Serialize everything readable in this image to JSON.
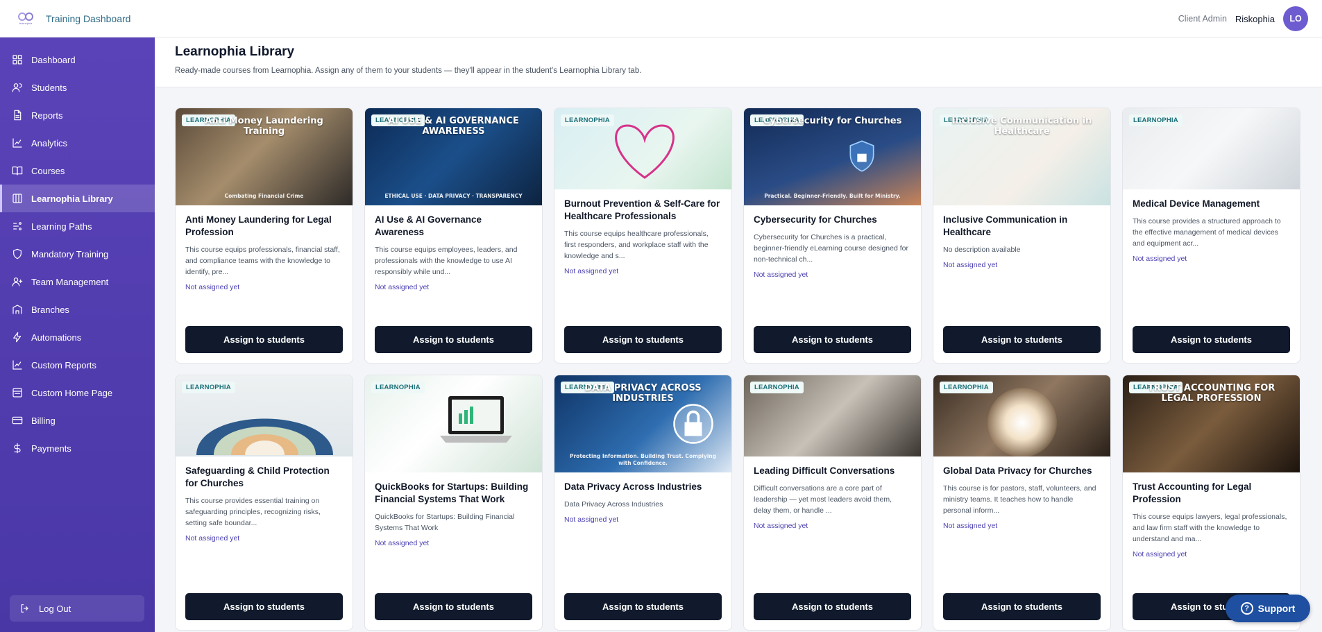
{
  "app": {
    "title": "Training Dashboard",
    "logo_text": "learnophia"
  },
  "user": {
    "role": "Client Admin",
    "org": "Riskophia",
    "initials": "LO"
  },
  "sidebar": {
    "items": [
      {
        "label": "Dashboard",
        "icon": "grid-icon"
      },
      {
        "label": "Students",
        "icon": "users-icon"
      },
      {
        "label": "Reports",
        "icon": "file-icon"
      },
      {
        "label": "Analytics",
        "icon": "chart-line-icon"
      },
      {
        "label": "Courses",
        "icon": "book-icon"
      },
      {
        "label": "Learnophia Library",
        "icon": "library-icon",
        "active": true
      },
      {
        "label": "Learning Paths",
        "icon": "path-icon"
      },
      {
        "label": "Mandatory Training",
        "icon": "shield-icon"
      },
      {
        "label": "Team Management",
        "icon": "team-icon"
      },
      {
        "label": "Branches",
        "icon": "building-icon"
      },
      {
        "label": "Automations",
        "icon": "bolt-icon"
      },
      {
        "label": "Custom Reports",
        "icon": "chart-line-icon"
      },
      {
        "label": "Custom Home Page",
        "icon": "layout-icon"
      },
      {
        "label": "Billing",
        "icon": "card-icon"
      },
      {
        "label": "Payments",
        "icon": "dollar-icon"
      }
    ],
    "logout_label": "Log Out"
  },
  "page": {
    "title": "Learnophia Library",
    "subtitle": "Ready-made courses from Learnophia. Assign any of them to your students — they'll appear in the student's Learnophia Library tab."
  },
  "badge_label": "LEARNOPHIA",
  "assign_label": "Assign to students",
  "courses": [
    {
      "title": "Anti Money Laundering for Legal Profession",
      "desc": "This course equips professionals, financial staff, and compliance teams with the knowledge to identify, pre...",
      "status": "Not assigned yet",
      "thumb_text": "Anti Money Laundering Training",
      "thumb_sub": "Combating Financial Crime"
    },
    {
      "title": "AI Use & AI Governance Awareness",
      "desc": "This course equips employees, leaders, and professionals with the knowledge to use AI responsibly while und...",
      "status": "Not assigned yet",
      "thumb_text": "AI USE & AI GOVERNANCE AWARENESS",
      "thumb_sub": "ETHICAL USE · DATA PRIVACY · TRANSPARENCY"
    },
    {
      "title": "Burnout Prevention & Self-Care for Healthcare Professionals",
      "desc": "This course equips healthcare professionals, first responders, and workplace staff with the knowledge and s...",
      "status": "Not assigned yet",
      "thumb_text": "",
      "thumb_sub": ""
    },
    {
      "title": "Cybersecurity for Churches",
      "desc": "Cybersecurity for Churches is a practical, beginner-friendly eLearning course designed for non-technical ch...",
      "status": "Not assigned yet",
      "thumb_text": "Cybersecurity for Churches",
      "thumb_sub": "Practical. Beginner-Friendly. Built for Ministry."
    },
    {
      "title": "Inclusive Communication in Healthcare",
      "desc": "No description available",
      "status": "Not assigned yet",
      "thumb_text": "Inclusive Communication in Healthcare",
      "thumb_sub": ""
    },
    {
      "title": "Medical Device Management",
      "desc": "This course provides a structured approach to the effective management of medical devices and equipment acr...",
      "status": "Not assigned yet",
      "thumb_text": "",
      "thumb_sub": ""
    },
    {
      "title": "Safeguarding & Child Protection for Churches",
      "desc": "This course provides essential training on safeguarding principles, recognizing risks, setting safe boundar...",
      "status": "Not assigned yet",
      "thumb_text": "",
      "thumb_sub": ""
    },
    {
      "title": "QuickBooks for Startups: Building Financial Systems That Work",
      "desc": "QuickBooks for Startups: Building Financial Systems That Work",
      "status": "Not assigned yet",
      "thumb_text": "",
      "thumb_sub": ""
    },
    {
      "title": "Data Privacy Across Industries",
      "desc": "Data Privacy Across Industries",
      "status": "Not assigned yet",
      "thumb_text": "DATA PRIVACY ACROSS INDUSTRIES",
      "thumb_sub": "Protecting Information. Building Trust. Complying with Confidence."
    },
    {
      "title": "Leading Difficult Conversations",
      "desc": "Difficult conversations are a core part of leadership — yet most leaders avoid them, delay them, or handle ...",
      "status": "Not assigned yet",
      "thumb_text": "",
      "thumb_sub": ""
    },
    {
      "title": "Global Data Privacy for Churches",
      "desc": "This course is for pastors, staff, volunteers, and ministry teams. It teaches how to handle personal inform...",
      "status": "Not assigned yet",
      "thumb_text": "",
      "thumb_sub": ""
    },
    {
      "title": "Trust Accounting for Legal Profession",
      "desc": "This course equips lawyers, legal professionals, and law firm staff with the knowledge to understand and ma...",
      "status": "Not assigned yet",
      "thumb_text": "TRUST ACCOUNTING FOR LEGAL PROFESSION",
      "thumb_sub": ""
    }
  ],
  "support_label": "Support"
}
